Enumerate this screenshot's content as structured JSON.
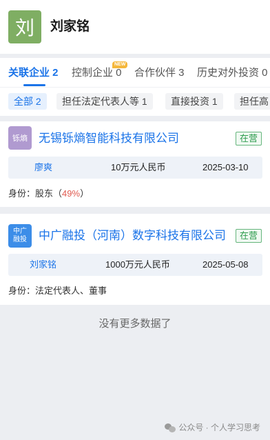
{
  "header": {
    "avatar_char": "刘",
    "person_name": "刘家铭"
  },
  "tabs": [
    {
      "label": "关联企业 2",
      "active": true
    },
    {
      "label": "控制企业 0",
      "active": false,
      "badge": "NEW"
    },
    {
      "label": "合作伙伴 3",
      "active": false
    },
    {
      "label": "历史对外投资 0",
      "active": false
    }
  ],
  "filters": [
    {
      "label": "全部 2",
      "active": true
    },
    {
      "label": "担任法定代表人等 1",
      "active": false
    },
    {
      "label": "直接投资 1",
      "active": false
    },
    {
      "label": "担任高",
      "active": false
    }
  ],
  "companies": [
    {
      "logo_text": "铄熵",
      "name": "无锡铄熵智能科技有限公司",
      "status": "在营",
      "legal_rep": "廖爽",
      "capital": "10万元人民币",
      "date": "2025-03-10",
      "role_label": "身份：",
      "role": "股东（",
      "role_pct": "49%",
      "role_end": "）"
    },
    {
      "logo_text": "中广\n融投",
      "name": "中广融投（河南）数字科技有限公司",
      "status": "在营",
      "legal_rep": "刘家铭",
      "capital": "1000万元人民币",
      "date": "2025-05-08",
      "role_label": "身份：",
      "role": "法定代表人、董事"
    }
  ],
  "footer": {
    "no_more": "没有更多数据了"
  },
  "watermark": {
    "text": "公众号 · 个人学习思考"
  },
  "colors": {
    "accent": "#1a73e8",
    "status_green": "#2e9c4e",
    "avatar_bg": "#7fae63",
    "badge": "#f5b73b",
    "percent": "#e05a4f"
  }
}
